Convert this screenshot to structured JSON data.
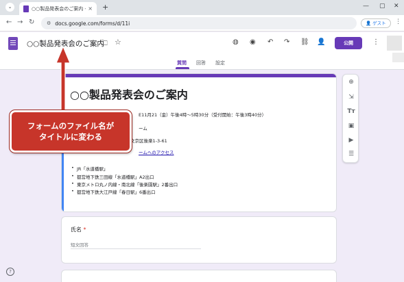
{
  "browser": {
    "tab_title": "○○製品発表会のご案内 - Goo",
    "tab_close": "×",
    "new_tab": "+",
    "url": "docs.google.com/forms/d/11i",
    "guest_label": "ゲスト",
    "minimize": "—",
    "maximize": "▢",
    "close": "✕"
  },
  "header": {
    "doc_title": "○○製品発表会のご案内",
    "publish_label": "公開",
    "tabs": [
      {
        "label": "質問"
      },
      {
        "label": "回答"
      },
      {
        "label": "設定"
      }
    ]
  },
  "form": {
    "title": "○○製品発表会のご案内",
    "desc_lines": [
      "E11月21（金）午後4時〜5時30分（受付開始：午後3時40分）",
      "ーム",
      "文京区後楽1-3-61",
      "ームへのアクセス"
    ],
    "bullets": [
      "JR「水道橋駅」",
      "都営地下鉄三田線「水道橋駅」A2出口",
      "東京メトロ丸ノ内線・南北線「後楽園駅」2番出口",
      "都営地下鉄大江戸線「春日駅」6番出口"
    ],
    "question": {
      "label": "氏名",
      "required_mark": "*",
      "placeholder": "短文回答"
    }
  },
  "callout": {
    "line1": "フォームのファイル名が",
    "line2": "タイトルに変わる",
    "color": "#c7352a"
  },
  "colors": {
    "accent": "#673ab7",
    "blue_bar": "#4285f4",
    "background": "#f0ebf8"
  }
}
